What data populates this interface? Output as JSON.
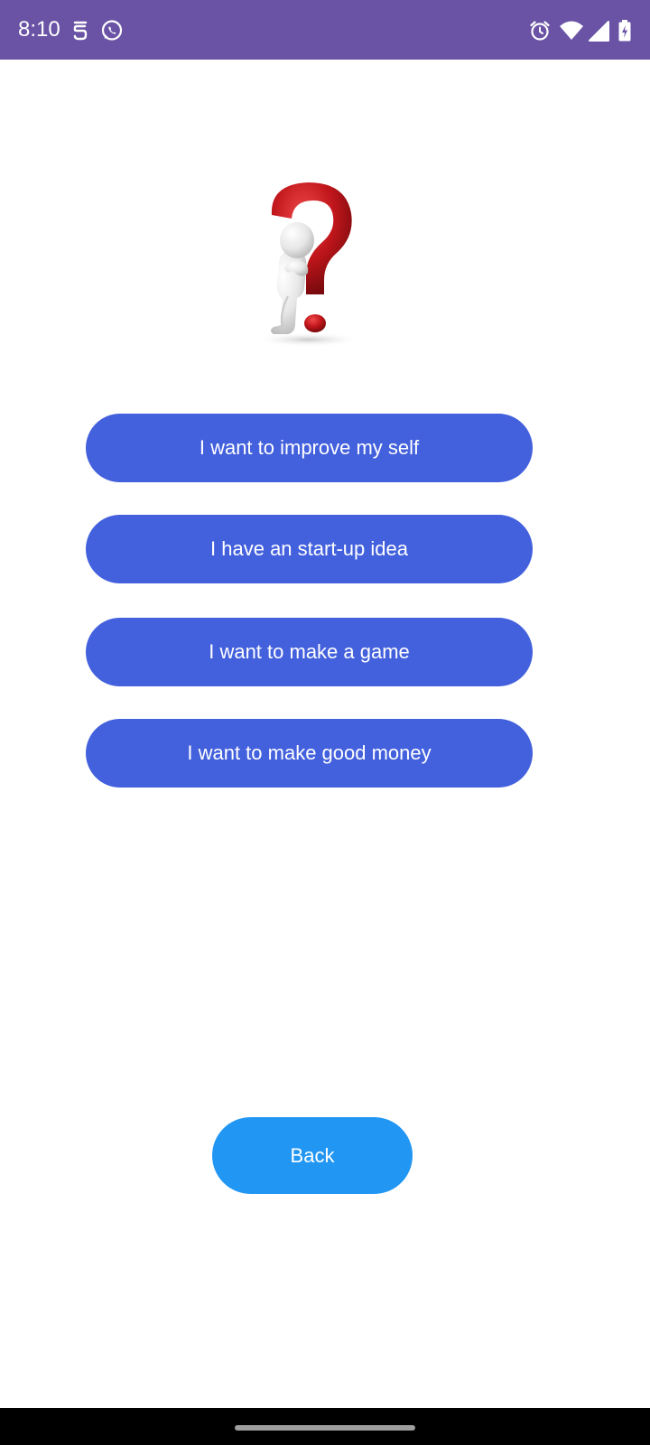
{
  "status_bar": {
    "time": "8:10",
    "background": "#6a53a5",
    "left_icons": [
      "s-notification-icon",
      "whatsapp-icon"
    ],
    "right_icons": [
      "alarm-icon",
      "wifi-icon",
      "signal-icon",
      "battery-icon"
    ]
  },
  "illustration": {
    "icon": "thinking-person-question-mark",
    "accent": "#c0161b"
  },
  "options": [
    {
      "label": "I want to improve my self"
    },
    {
      "label": "I have an start-up idea"
    },
    {
      "label": "I want to make a game"
    },
    {
      "label": "I want to make good money"
    }
  ],
  "back_button": {
    "label": "Back"
  },
  "colors": {
    "option_button": "#4360dd",
    "back_button": "#2196f3",
    "text": "#ffffff"
  }
}
